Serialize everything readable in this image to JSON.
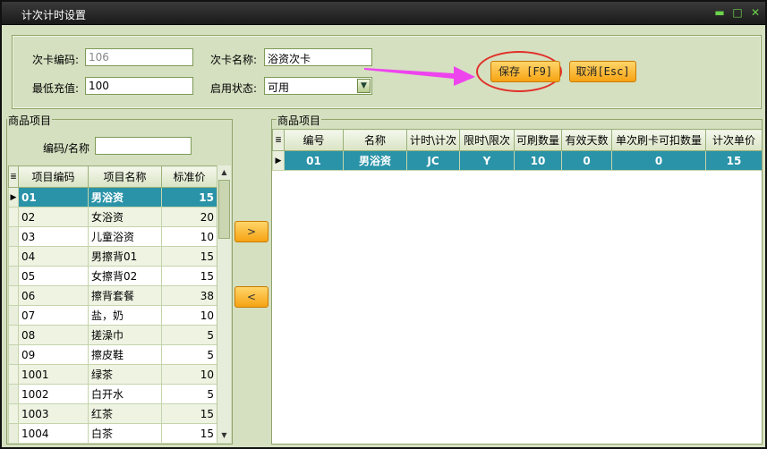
{
  "window": {
    "title": "计次计时设置"
  },
  "form": {
    "card_code_label": "次卡编码:",
    "card_code_value": "106",
    "card_name_label": "次卡名称:",
    "card_name_value": "浴资次卡",
    "min_recharge_label": "最低充值:",
    "min_recharge_value": "100",
    "status_label": "启用状态:",
    "status_value": "可用"
  },
  "buttons": {
    "save": "保存 [F9]",
    "cancel": "取消[Esc]",
    "add": ">",
    "remove": "<"
  },
  "left": {
    "group_title": "商品项目",
    "search_label": "编码/名称",
    "search_value": "",
    "columns": [
      "项目编码",
      "项目名称",
      "标准价"
    ],
    "rows": [
      [
        "01",
        "男浴资",
        "15"
      ],
      [
        "02",
        "女浴资",
        "20"
      ],
      [
        "03",
        "儿童浴资",
        "10"
      ],
      [
        "04",
        "男擦背01",
        "15"
      ],
      [
        "05",
        "女擦背02",
        "15"
      ],
      [
        "06",
        "擦背套餐",
        "38"
      ],
      [
        "07",
        "盐，奶",
        "10"
      ],
      [
        "08",
        "搓澡巾",
        "5"
      ],
      [
        "09",
        "擦皮鞋",
        "5"
      ],
      [
        "1001",
        "绿茶",
        "10"
      ],
      [
        "1002",
        "白开水",
        "5"
      ],
      [
        "1003",
        "红茶",
        "15"
      ],
      [
        "1004",
        "白茶",
        "15"
      ]
    ]
  },
  "right": {
    "group_title": "商品项目",
    "columns": [
      "编号",
      "名称",
      "计时\\计次",
      "限时\\限次",
      "可刷数量",
      "有效天数",
      "单次刷卡可扣数量",
      "计次单价"
    ],
    "rows": [
      [
        "01",
        "男浴资",
        "JC",
        "Y",
        "10",
        "0",
        "0",
        "15"
      ]
    ]
  },
  "colors": {
    "accent": "#2a93a8",
    "button": "#f6a313",
    "annotation": "#e0302a",
    "arrow": "#ee44ee"
  }
}
